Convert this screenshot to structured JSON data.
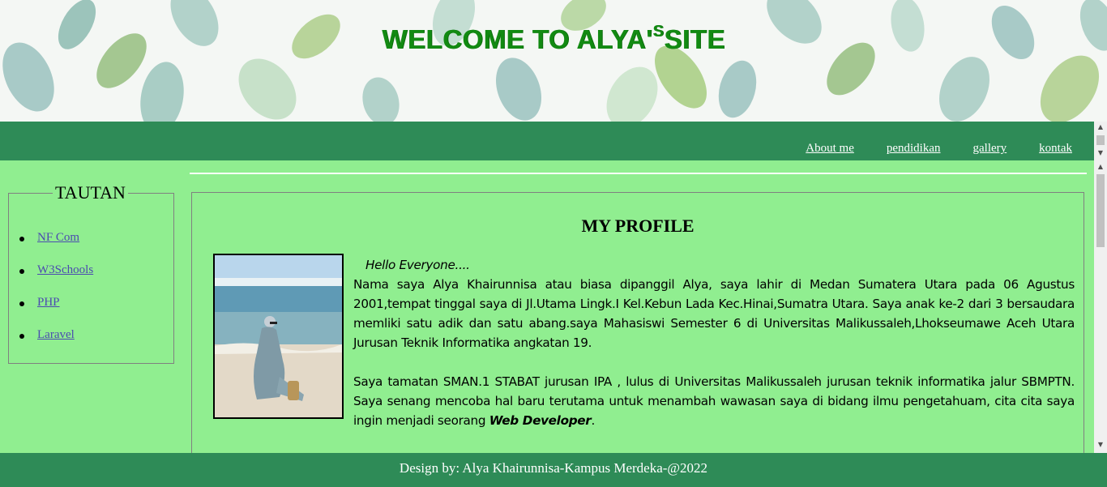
{
  "header": {
    "title_main": "WELCOME TO ALYA'",
    "title_sup": "S",
    "title_end": "SITE"
  },
  "nav": {
    "items": [
      {
        "label": "About me"
      },
      {
        "label": "pendidikan"
      },
      {
        "label": "gallery"
      },
      {
        "label": "kontak"
      }
    ]
  },
  "sidebar": {
    "legend": "TAUTAN",
    "links": [
      {
        "label": "NF Com"
      },
      {
        "label": "W3Schools"
      },
      {
        "label": "PHP"
      },
      {
        "label": "Laravel"
      }
    ]
  },
  "profile": {
    "title": "MY PROFILE",
    "greeting": "Hello Everyone....",
    "paragraph1": "Nama saya Alya Khairunnisa atau biasa dipanggil Alya, saya lahir di Medan Sumatera Utara pada 06 Agustus 2001,tempat tinggal saya di Jl.Utama Lingk.I Kel.Kebun Lada Kec.Hinai,Sumatra Utara. Saya anak ke-2 dari 3 bersaudara memliki satu adik dan satu abang.saya Mahasiswi Semester 6 di Universitas Malikussaleh,Lhokseumawe Aceh Utara Jurusan Teknik Informatika angkatan 19.",
    "paragraph2_start": "Saya tamatan SMAN.1 STABAT jurusan IPA , lulus di Universitas Malikussaleh jurusan teknik informatika jalur SBMPTN. Saya senang mencoba hal baru terutama untuk menambah wawasan saya di bidang ilmu pengetahuam, cita cita saya ingin menjadi seorang ",
    "paragraph2_bold": "Web Developer",
    "paragraph2_end": "."
  },
  "footer": {
    "text": "Design by: Alya Khairunnisa-Kampus Merdeka-@2022"
  },
  "colors": {
    "page_bg": "#90ee90",
    "bar_bg": "#2e8b57",
    "title": "#128a12"
  }
}
